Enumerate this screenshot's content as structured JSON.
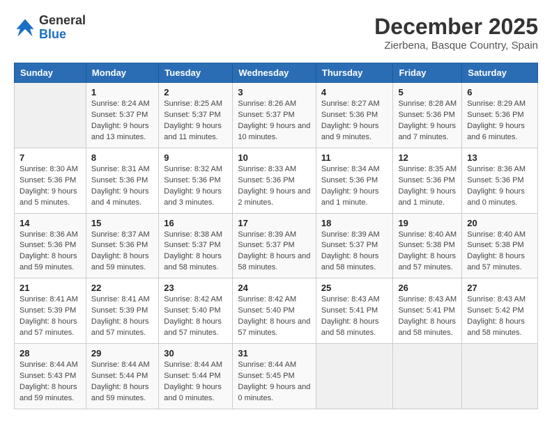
{
  "logo": {
    "general": "General",
    "blue": "Blue"
  },
  "title": {
    "month_year": "December 2025",
    "location": "Zierbena, Basque Country, Spain"
  },
  "headers": [
    "Sunday",
    "Monday",
    "Tuesday",
    "Wednesday",
    "Thursday",
    "Friday",
    "Saturday"
  ],
  "weeks": [
    [
      {
        "day": "",
        "sunrise": "",
        "sunset": "",
        "daylight": ""
      },
      {
        "day": "1",
        "sunrise": "Sunrise: 8:24 AM",
        "sunset": "Sunset: 5:37 PM",
        "daylight": "Daylight: 9 hours and 13 minutes."
      },
      {
        "day": "2",
        "sunrise": "Sunrise: 8:25 AM",
        "sunset": "Sunset: 5:37 PM",
        "daylight": "Daylight: 9 hours and 11 minutes."
      },
      {
        "day": "3",
        "sunrise": "Sunrise: 8:26 AM",
        "sunset": "Sunset: 5:37 PM",
        "daylight": "Daylight: 9 hours and 10 minutes."
      },
      {
        "day": "4",
        "sunrise": "Sunrise: 8:27 AM",
        "sunset": "Sunset: 5:36 PM",
        "daylight": "Daylight: 9 hours and 9 minutes."
      },
      {
        "day": "5",
        "sunrise": "Sunrise: 8:28 AM",
        "sunset": "Sunset: 5:36 PM",
        "daylight": "Daylight: 9 hours and 7 minutes."
      },
      {
        "day": "6",
        "sunrise": "Sunrise: 8:29 AM",
        "sunset": "Sunset: 5:36 PM",
        "daylight": "Daylight: 9 hours and 6 minutes."
      }
    ],
    [
      {
        "day": "7",
        "sunrise": "Sunrise: 8:30 AM",
        "sunset": "Sunset: 5:36 PM",
        "daylight": "Daylight: 9 hours and 5 minutes."
      },
      {
        "day": "8",
        "sunrise": "Sunrise: 8:31 AM",
        "sunset": "Sunset: 5:36 PM",
        "daylight": "Daylight: 9 hours and 4 minutes."
      },
      {
        "day": "9",
        "sunrise": "Sunrise: 8:32 AM",
        "sunset": "Sunset: 5:36 PM",
        "daylight": "Daylight: 9 hours and 3 minutes."
      },
      {
        "day": "10",
        "sunrise": "Sunrise: 8:33 AM",
        "sunset": "Sunset: 5:36 PM",
        "daylight": "Daylight: 9 hours and 2 minutes."
      },
      {
        "day": "11",
        "sunrise": "Sunrise: 8:34 AM",
        "sunset": "Sunset: 5:36 PM",
        "daylight": "Daylight: 9 hours and 1 minute."
      },
      {
        "day": "12",
        "sunrise": "Sunrise: 8:35 AM",
        "sunset": "Sunset: 5:36 PM",
        "daylight": "Daylight: 9 hours and 1 minute."
      },
      {
        "day": "13",
        "sunrise": "Sunrise: 8:36 AM",
        "sunset": "Sunset: 5:36 PM",
        "daylight": "Daylight: 9 hours and 0 minutes."
      }
    ],
    [
      {
        "day": "14",
        "sunrise": "Sunrise: 8:36 AM",
        "sunset": "Sunset: 5:36 PM",
        "daylight": "Daylight: 8 hours and 59 minutes."
      },
      {
        "day": "15",
        "sunrise": "Sunrise: 8:37 AM",
        "sunset": "Sunset: 5:36 PM",
        "daylight": "Daylight: 8 hours and 59 minutes."
      },
      {
        "day": "16",
        "sunrise": "Sunrise: 8:38 AM",
        "sunset": "Sunset: 5:37 PM",
        "daylight": "Daylight: 8 hours and 58 minutes."
      },
      {
        "day": "17",
        "sunrise": "Sunrise: 8:39 AM",
        "sunset": "Sunset: 5:37 PM",
        "daylight": "Daylight: 8 hours and 58 minutes."
      },
      {
        "day": "18",
        "sunrise": "Sunrise: 8:39 AM",
        "sunset": "Sunset: 5:37 PM",
        "daylight": "Daylight: 8 hours and 58 minutes."
      },
      {
        "day": "19",
        "sunrise": "Sunrise: 8:40 AM",
        "sunset": "Sunset: 5:38 PM",
        "daylight": "Daylight: 8 hours and 57 minutes."
      },
      {
        "day": "20",
        "sunrise": "Sunrise: 8:40 AM",
        "sunset": "Sunset: 5:38 PM",
        "daylight": "Daylight: 8 hours and 57 minutes."
      }
    ],
    [
      {
        "day": "21",
        "sunrise": "Sunrise: 8:41 AM",
        "sunset": "Sunset: 5:39 PM",
        "daylight": "Daylight: 8 hours and 57 minutes."
      },
      {
        "day": "22",
        "sunrise": "Sunrise: 8:41 AM",
        "sunset": "Sunset: 5:39 PM",
        "daylight": "Daylight: 8 hours and 57 minutes."
      },
      {
        "day": "23",
        "sunrise": "Sunrise: 8:42 AM",
        "sunset": "Sunset: 5:40 PM",
        "daylight": "Daylight: 8 hours and 57 minutes."
      },
      {
        "day": "24",
        "sunrise": "Sunrise: 8:42 AM",
        "sunset": "Sunset: 5:40 PM",
        "daylight": "Daylight: 8 hours and 57 minutes."
      },
      {
        "day": "25",
        "sunrise": "Sunrise: 8:43 AM",
        "sunset": "Sunset: 5:41 PM",
        "daylight": "Daylight: 8 hours and 58 minutes."
      },
      {
        "day": "26",
        "sunrise": "Sunrise: 8:43 AM",
        "sunset": "Sunset: 5:41 PM",
        "daylight": "Daylight: 8 hours and 58 minutes."
      },
      {
        "day": "27",
        "sunrise": "Sunrise: 8:43 AM",
        "sunset": "Sunset: 5:42 PM",
        "daylight": "Daylight: 8 hours and 58 minutes."
      }
    ],
    [
      {
        "day": "28",
        "sunrise": "Sunrise: 8:44 AM",
        "sunset": "Sunset: 5:43 PM",
        "daylight": "Daylight: 8 hours and 59 minutes."
      },
      {
        "day": "29",
        "sunrise": "Sunrise: 8:44 AM",
        "sunset": "Sunset: 5:44 PM",
        "daylight": "Daylight: 8 hours and 59 minutes."
      },
      {
        "day": "30",
        "sunrise": "Sunrise: 8:44 AM",
        "sunset": "Sunset: 5:44 PM",
        "daylight": "Daylight: 9 hours and 0 minutes."
      },
      {
        "day": "31",
        "sunrise": "Sunrise: 8:44 AM",
        "sunset": "Sunset: 5:45 PM",
        "daylight": "Daylight: 9 hours and 0 minutes."
      },
      {
        "day": "",
        "sunrise": "",
        "sunset": "",
        "daylight": ""
      },
      {
        "day": "",
        "sunrise": "",
        "sunset": "",
        "daylight": ""
      },
      {
        "day": "",
        "sunrise": "",
        "sunset": "",
        "daylight": ""
      }
    ]
  ]
}
